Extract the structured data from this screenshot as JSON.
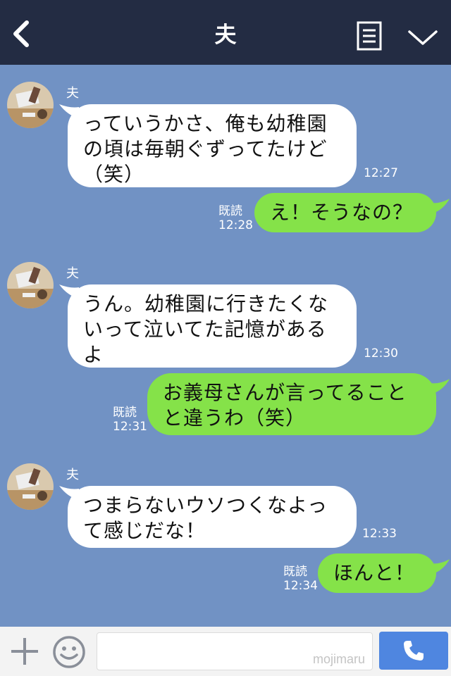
{
  "header": {
    "title": "夫"
  },
  "messages": [
    {
      "side": "in",
      "sender": "夫",
      "text": "っていうかさ、俺も幼稚園\nの頃は毎朝ぐずってたけど\n（笑）",
      "time": "12:27"
    },
    {
      "side": "out",
      "text": "え！そうなの？",
      "read": "既読",
      "time": "12:28"
    },
    {
      "side": "in",
      "sender": "夫",
      "text": "うん。幼稚園に行きたくな\nいって泣いてた記憶がある\nよ",
      "time": "12:30"
    },
    {
      "side": "out",
      "text": "お義母さんが言ってること\nと違うわ（笑）",
      "read": "既読",
      "time": "12:31"
    },
    {
      "side": "in",
      "sender": "夫",
      "text": "つまらないウソつくなよっ\nて感じだな！",
      "time": "12:33"
    },
    {
      "side": "out",
      "text": "ほんと！",
      "read": "既読",
      "time": "12:34"
    }
  ],
  "footer": {
    "input_placeholder": "",
    "watermark": "mojimaru"
  },
  "colors": {
    "header_bg": "#232c43",
    "chat_bg": "#7192c4",
    "incoming": "#ffffff",
    "outgoing": "#85e249",
    "call_button": "#4f86e0"
  },
  "icons": [
    "back-icon",
    "menu-icon",
    "chevron-down-icon",
    "plus-icon",
    "emoji-icon",
    "phone-icon"
  ]
}
